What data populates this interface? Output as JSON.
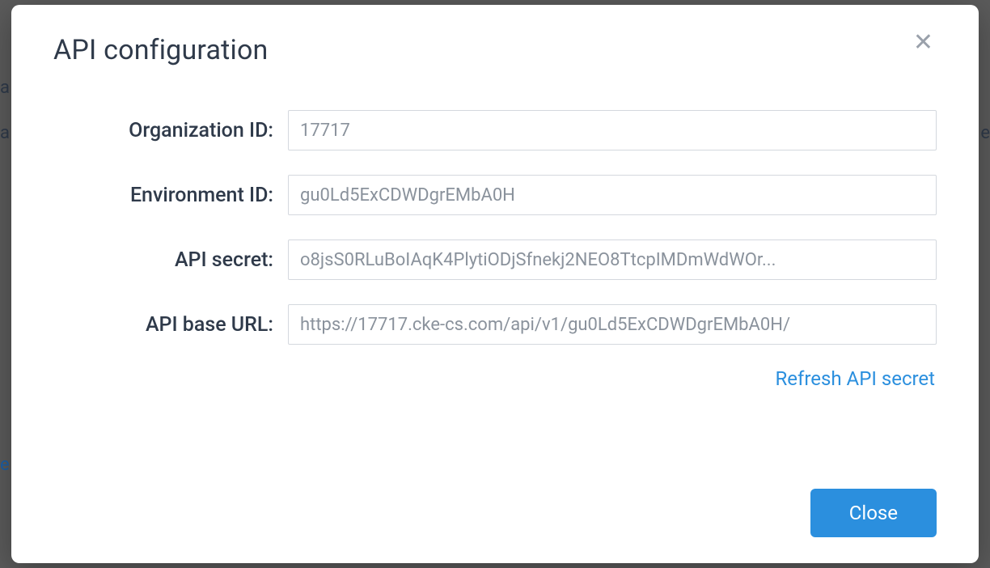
{
  "modal": {
    "title": "API configuration",
    "fields": {
      "organization_id": {
        "label": "Organization ID:",
        "value": "17717"
      },
      "environment_id": {
        "label": "Environment ID:",
        "value": "gu0Ld5ExCDWDgrEMbA0H"
      },
      "api_secret": {
        "label": "API secret:",
        "value": "o8jsS0RLuBoIAqK4PlytiODjSfnekj2NEO8TtcpIMDmWdWOr..."
      },
      "api_base_url": {
        "label": "API base URL:",
        "value": "https://17717.cke-cs.com/api/v1/gu0Ld5ExCDWDgrEMbA0H/"
      }
    },
    "refresh_link": "Refresh API secret",
    "close_button": "Close"
  },
  "background": {
    "frag1": "a",
    "frag2": "a",
    "frag3": "e",
    "frag4": "e"
  }
}
